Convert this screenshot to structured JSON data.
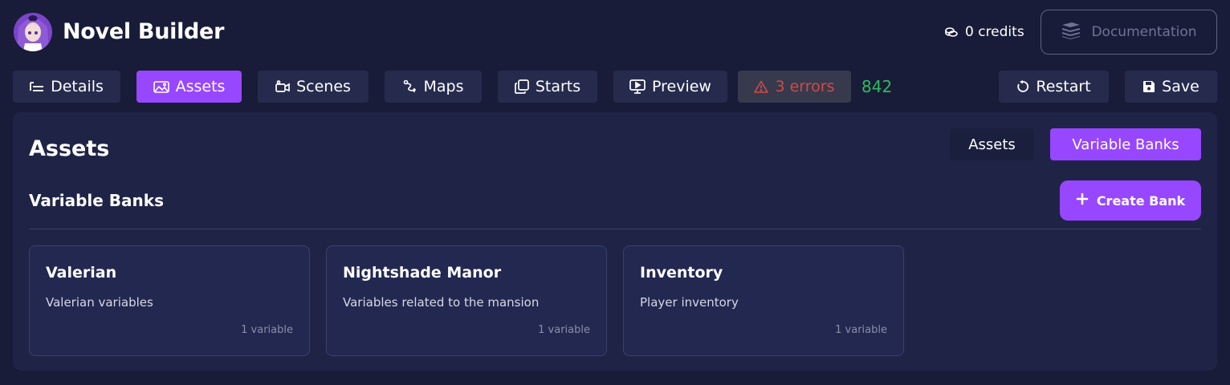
{
  "header": {
    "app_title": "Novel Builder",
    "credits_label": "0 credits",
    "documentation_label": "Documentation"
  },
  "toolbar": {
    "details_label": "Details",
    "assets_label": "Assets",
    "scenes_label": "Scenes",
    "maps_label": "Maps",
    "starts_label": "Starts",
    "preview_label": "Preview",
    "errors_label": "3 errors",
    "count_value": "842",
    "restart_label": "Restart",
    "save_label": "Save",
    "active_tab": "Assets"
  },
  "panel": {
    "title": "Assets",
    "segment_assets_label": "Assets",
    "segment_banks_label": "Variable Banks",
    "active_segment": "Variable Banks",
    "section_title": "Variable Banks",
    "create_button_label": "Create Bank"
  },
  "banks": [
    {
      "name": "Valerian",
      "description": "Valerian variables",
      "count": "1 variable"
    },
    {
      "name": "Nightshade Manor",
      "description": "Variables related to the mansion",
      "count": "1 variable"
    },
    {
      "name": "Inventory",
      "description": "Player inventory",
      "count": "1 variable"
    }
  ],
  "colors": {
    "background": "#181c38",
    "panel": "#1f2447",
    "accent": "#9747ff",
    "button": "#262b4e",
    "error_text": "#d04a4a",
    "count_text": "#2ebd5c"
  },
  "icons": {
    "logo": "avatar-logo",
    "credits": "coins-icon",
    "documentation": "books-icon",
    "details": "list-icon",
    "assets": "image-icon",
    "scenes": "video-camera-icon",
    "maps": "route-icon",
    "starts": "copy-icon",
    "preview": "monitor-play-icon",
    "errors": "warning-triangle-icon",
    "restart": "refresh-icon",
    "save": "floppy-disk-icon",
    "create": "plus-icon"
  }
}
